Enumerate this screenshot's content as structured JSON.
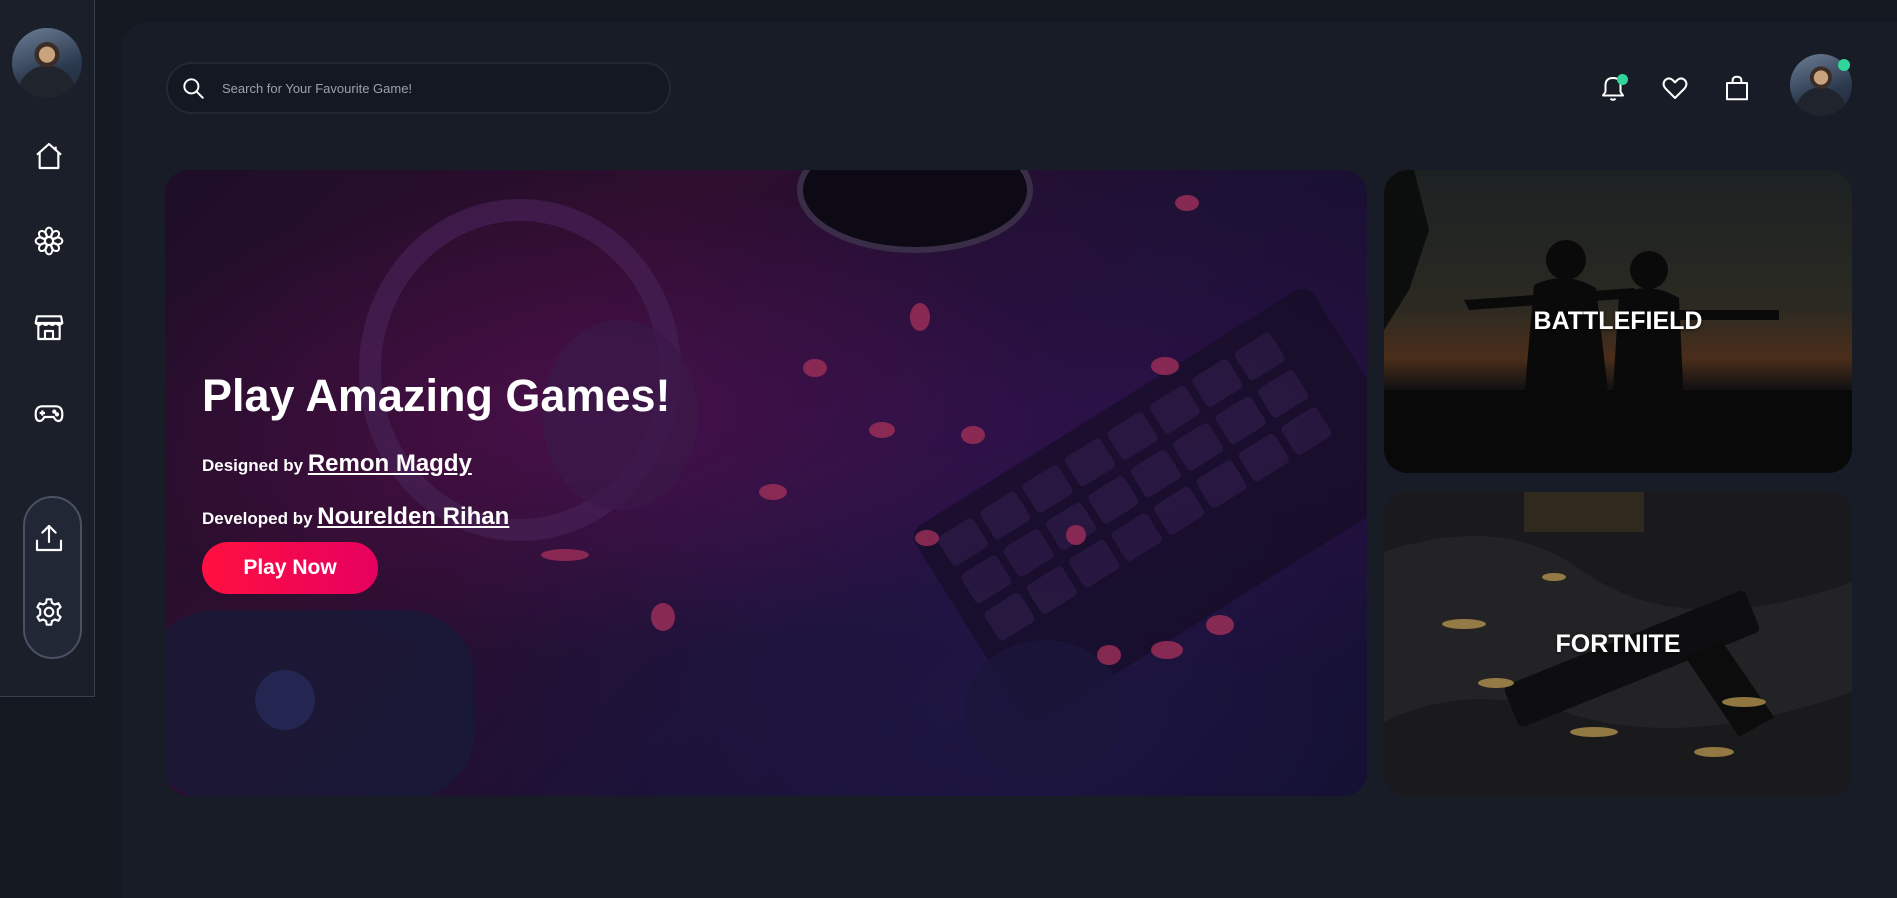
{
  "search": {
    "placeholder": "Search for Your Favourite Game!"
  },
  "hero": {
    "title": "Play Amazing Games!",
    "designed_label": "Designed by",
    "designer": "Remon Magdy",
    "developed_label": "Developed by",
    "developer": "Nourelden Rihan",
    "cta": "Play Now"
  },
  "cards": [
    {
      "title": "BATTLEFIELD"
    },
    {
      "title": "FORTNITE"
    }
  ],
  "icons": {
    "sidebar": [
      "home-icon",
      "flower-icon",
      "store-icon",
      "gamepad-icon",
      "upload-icon",
      "settings-icon"
    ],
    "topbar": [
      "bell-icon",
      "heart-icon",
      "shopping-bag-icon"
    ]
  },
  "colors": {
    "accent": "#ff1040",
    "status": "#2fd59a",
    "background": "#141821",
    "panel": "#181c26"
  }
}
